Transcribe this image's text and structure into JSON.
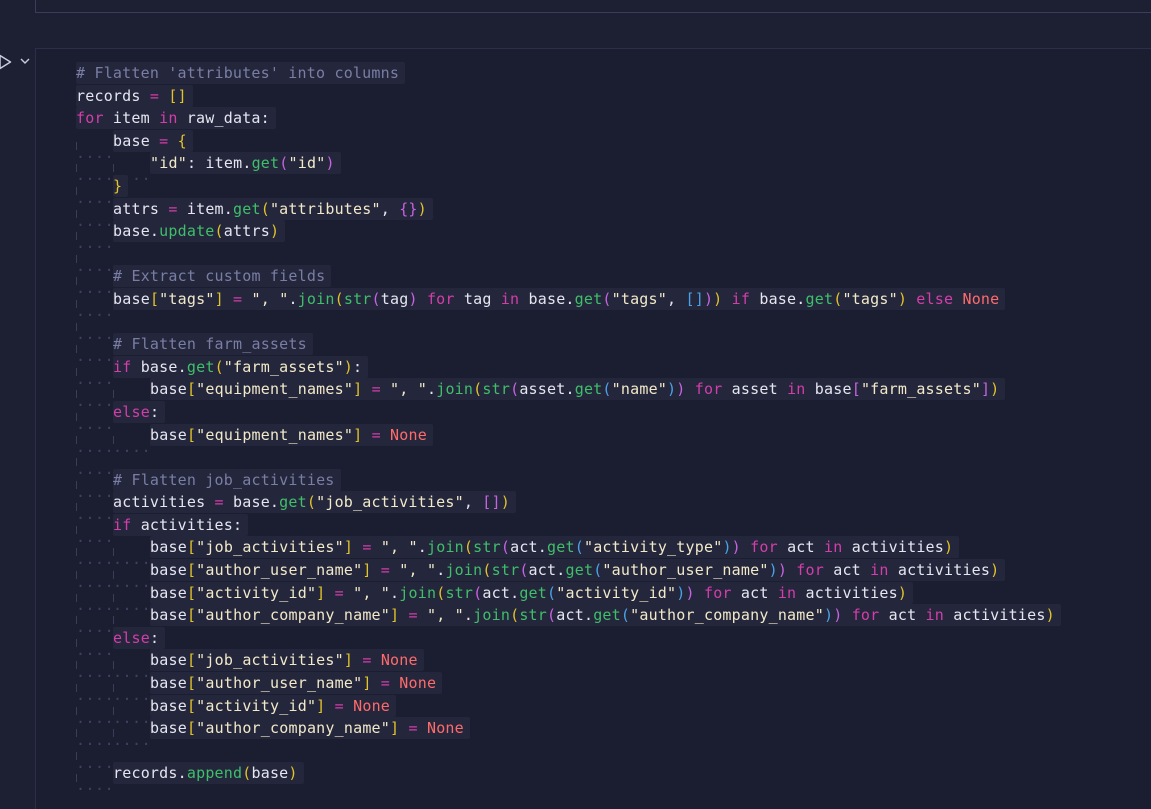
{
  "notebook": {
    "cell": {
      "run_icon": "run-triangle-icon",
      "collapse_icon": "chevron-down-icon"
    }
  },
  "code_lines": [
    "# Flatten 'attributes' into columns",
    "records = []",
    "for item in raw_data:",
    "    base = {",
    "        \"id\": item.get(\"id\")",
    "    }",
    "    attrs = item.get(\"attributes\", {})",
    "    base.update(attrs)",
    "",
    "    # Extract custom fields",
    "    base[\"tags\"] = \", \".join(str(tag) for tag in base.get(\"tags\", [])) if base.get(\"tags\") else None",
    "",
    "    # Flatten farm_assets",
    "    if base.get(\"farm_assets\"):",
    "        base[\"equipment_names\"] = \", \".join(str(asset.get(\"name\")) for asset in base[\"farm_assets\"])",
    "    else:",
    "        base[\"equipment_names\"] = None",
    "",
    "    # Flatten job_activities",
    "    activities = base.get(\"job_activities\", [])",
    "    if activities:",
    "        base[\"job_activities\"] = \", \".join(str(act.get(\"activity_type\")) for act in activities)",
    "        base[\"author_user_name\"] = \", \".join(str(act.get(\"author_user_name\")) for act in activities)",
    "        base[\"activity_id\"] = \", \".join(str(act.get(\"activity_id\")) for act in activities)",
    "        base[\"author_company_name\"] = \", \".join(str(act.get(\"author_company_name\")) for act in activities)",
    "    else:",
    "        base[\"job_activities\"] = None",
    "        base[\"author_user_name\"] = None",
    "        base[\"activity_id\"] = None",
    "        base[\"author_company_name\"] = None",
    "",
    "    records.append(base)"
  ],
  "colors": {
    "background": "#1d1f33",
    "keyword": "#d33ea9",
    "string": "#f2e9c9",
    "function": "#3fbf6a",
    "bracket": "#e2c32a",
    "comment": "#7a7ea3",
    "none": "#ff6b6b"
  }
}
